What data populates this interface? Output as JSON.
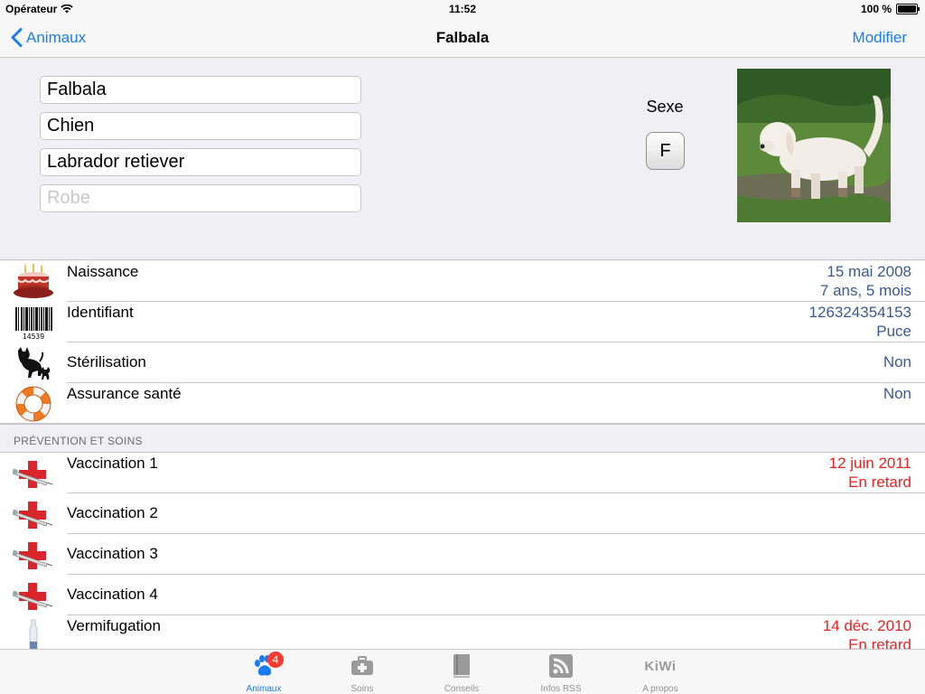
{
  "status_bar": {
    "carrier": "Opérateur",
    "time": "11:52",
    "battery": "100 %"
  },
  "nav": {
    "back_label": "Animaux",
    "title": "Falbala",
    "edit_label": "Modifier"
  },
  "form": {
    "name": "Falbala",
    "species": "Chien",
    "breed": "Labrador retiever",
    "coat_value": "",
    "coat_placeholder": "Robe",
    "sex_label": "Sexe",
    "sex_value": "F"
  },
  "info_rows": [
    {
      "icon": "birthday-cake-icon",
      "label": "Naissance",
      "value_line1": "15 mai 2008",
      "value_line2": "7 ans, 5 mois"
    },
    {
      "icon": "barcode-icon",
      "label": "Identifiant",
      "value_line1": "126324354153",
      "value_line2": "Puce",
      "barcode_text": "14539"
    },
    {
      "icon": "cat-dog-silhouette-icon",
      "label": "Stérilisation",
      "value_line1": "Non"
    },
    {
      "icon": "lifebuoy-icon",
      "label": "Assurance santé",
      "value_line1": "Non"
    }
  ],
  "section_header": "PRÉVENTION ET SOINS",
  "care_rows": [
    {
      "icon": "syringe-cross-icon",
      "label": "Vaccination 1",
      "value_line1": "12 juin 2011",
      "value_line2": "En retard",
      "status": "late"
    },
    {
      "icon": "syringe-cross-icon",
      "label": "Vaccination 2"
    },
    {
      "icon": "syringe-cross-icon",
      "label": "Vaccination 3"
    },
    {
      "icon": "syringe-cross-icon",
      "label": "Vaccination 4"
    },
    {
      "icon": "dewormer-bottle-icon",
      "label": "Vermifugation",
      "value_line1": "14 déc. 2010",
      "value_line2": "En retard",
      "status": "late"
    }
  ],
  "tabs": [
    {
      "icon": "paw-icon",
      "label": "Animaux",
      "badge": "4",
      "active": true
    },
    {
      "icon": "first-aid-kit-icon",
      "label": "Soins"
    },
    {
      "icon": "book-icon",
      "label": "Conseils"
    },
    {
      "icon": "rss-icon",
      "label": "Infos RSS"
    },
    {
      "icon": "kiwi-logo-icon",
      "label": "A propos",
      "logo_text": "KiWi"
    }
  ],
  "colors": {
    "accent": "#1a7cf3",
    "value": "#3a5a94",
    "late": "#f01e1e",
    "badge": "#ff3b30"
  }
}
